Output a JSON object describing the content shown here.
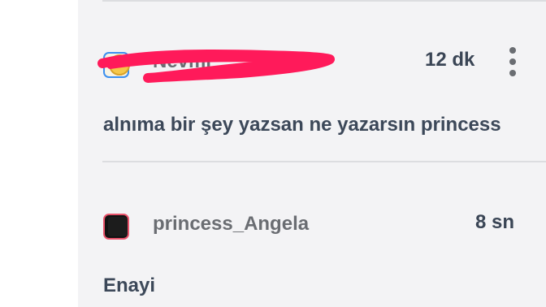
{
  "comments": [
    {
      "username": "Nevmi",
      "time": "12 dk",
      "text": "alnıma bir şey yazsan ne yazarsın princess"
    },
    {
      "username": "princess_Angela",
      "time": "8 sn",
      "text": "Enayi"
    }
  ],
  "colors": {
    "background": "#f3f3f5",
    "text_primary": "#3c4859",
    "text_username": "#6a6d72",
    "redaction": "#ff1a5a"
  },
  "icons": {
    "comment_1_avatar": "emoji-face-icon",
    "comment_2_avatar": "dark-profile-icon",
    "menu": "more-vertical-icon"
  }
}
